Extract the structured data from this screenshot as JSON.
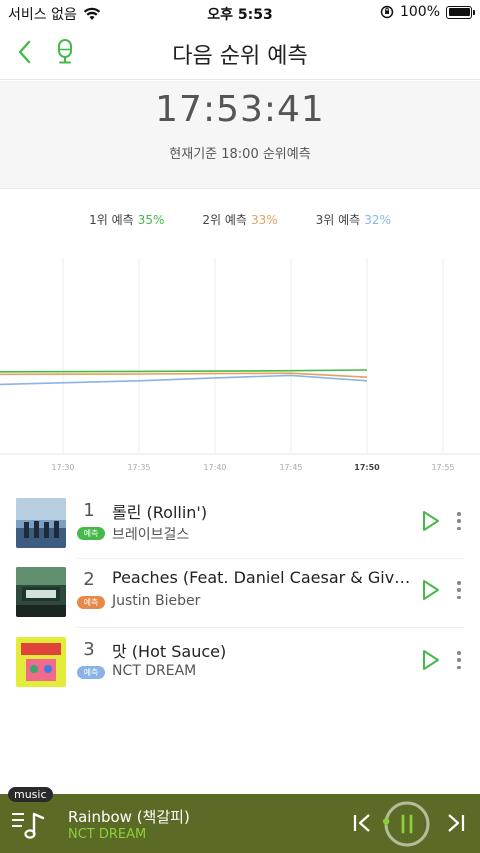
{
  "status_bar": {
    "carrier": "서비스 없음",
    "time": "오후 5:53",
    "battery": "100%",
    "icons": [
      "wifi-icon",
      "orientation-lock-icon",
      "battery-icon"
    ]
  },
  "header": {
    "title": "다음 순위 예측",
    "icons": [
      "back-icon",
      "mic-icon"
    ]
  },
  "clock": {
    "time": "17:53:41",
    "basis": "현재기준 18:00 순위예측"
  },
  "legend": [
    {
      "label": "1위 예측",
      "pct": "35%",
      "color": "#46b94a"
    },
    {
      "label": "2위 예측",
      "pct": "33%",
      "color": "#e8a05a"
    },
    {
      "label": "3위 예측",
      "pct": "32%",
      "color": "#8ab4e8"
    }
  ],
  "chart_data": {
    "type": "line",
    "x": [
      "17:30",
      "17:35",
      "17:40",
      "17:45",
      "17:50",
      "17:55"
    ],
    "highlight_tick": "17:50",
    "ylim": [
      0,
      100
    ],
    "grid": "vertical",
    "series": [
      {
        "name": "1위 예측",
        "color": "#46b94a",
        "points": [
          [
            0,
            34.5
          ],
          [
            1,
            34.6
          ],
          [
            2,
            34.7
          ],
          [
            3,
            34.8
          ],
          [
            4,
            35.0
          ]
        ]
      },
      {
        "name": "2위 예측",
        "color": "#e8a05a",
        "points": [
          [
            0,
            33.8
          ],
          [
            1,
            33.9
          ],
          [
            2,
            34.0
          ],
          [
            3,
            34.1
          ],
          [
            4,
            33.0
          ]
        ]
      },
      {
        "name": "3위 예측",
        "color": "#8ab4e8",
        "points": [
          [
            0,
            31.0
          ],
          [
            1,
            32.0
          ],
          [
            2,
            32.8
          ],
          [
            3,
            33.5
          ],
          [
            4,
            32.0
          ]
        ]
      }
    ]
  },
  "songs": [
    {
      "rank": "1",
      "title": "롤린 (Rollin')",
      "badge": "예측",
      "badge_color": "#46b94a",
      "artist": "브레이브걸스"
    },
    {
      "rank": "2",
      "title": "Peaches (Feat. Daniel Caesar & Giveon)",
      "badge": "예측",
      "badge_color": "#e8894a",
      "artist": "Justin Bieber"
    },
    {
      "rank": "3",
      "title": "맛 (Hot Sauce)",
      "badge": "예측",
      "badge_color": "#8ab4e8",
      "artist": "NCT DREAM"
    }
  ],
  "player": {
    "tag": "music",
    "title": "Rainbow (책갈피)",
    "artist": "NCT DREAM",
    "progress": 0.02
  },
  "colors": {
    "accent": "#46b94a",
    "player_bg": "#5b6b26"
  }
}
